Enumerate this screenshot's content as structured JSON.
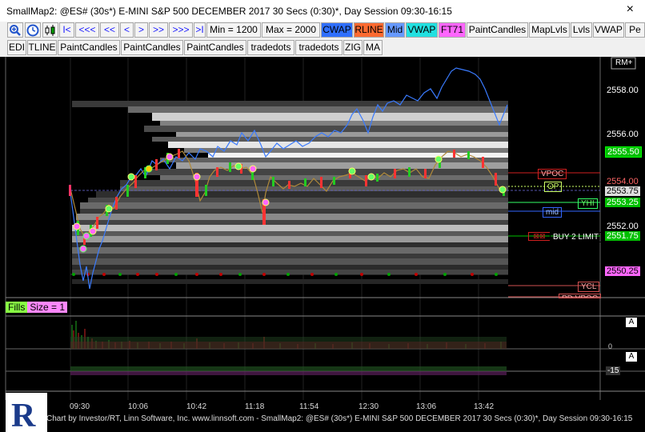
{
  "window": {
    "title": "SmallMap2: @ES# (30s*) E-MINI S&P 500 DECEMBER 2017 30 Secs (0:30)*, Day Session 09:30-16:15",
    "close": "×"
  },
  "toolbar1": {
    "nav": [
      "I<",
      "<<<",
      "<<",
      "<",
      ">",
      ">>",
      ">>>",
      ">I"
    ],
    "min": "Min = 1200",
    "max": "Max = 2000",
    "buttons": [
      "CWAP",
      "RLINE",
      "Mid",
      "VWAP",
      "FT71",
      "PaintCandles",
      "MapLvls",
      "Lvls",
      "VWAP",
      "Pe"
    ]
  },
  "toolbar2": {
    "buttons": [
      "EDI",
      "TLINE",
      "PaintCandles",
      "PaintCandles",
      "PaintCandles",
      "tradedots",
      "tradedots",
      "ZIG",
      "MA"
    ]
  },
  "chart": {
    "rm_button": "RM+",
    "price_labels": [
      "2558.00",
      "2556.00",
      "2555.50",
      "2554.00",
      "2553.75",
      "2553.25",
      "2552.00",
      "2551.75",
      "2550.25"
    ],
    "tags": {
      "vpoc": "VPOC",
      "op": "OP",
      "yhi": "YHI",
      "mid": "mid",
      "buy": "BUY 2 LIMIT",
      "ycl": "YCL",
      "pdvpoc": "PD VPOC"
    },
    "fills_label": "Fills",
    "size_label": "Size = 1",
    "pane_a1": "A",
    "pane_a2": "A",
    "pane_zero": "0",
    "pane_neg": "-15",
    "times": [
      "09:30",
      "10:06",
      "10:42",
      "11:18",
      "11:54",
      "12:30",
      "13:06",
      "13:42"
    ],
    "footer": "Chart by Investor/RT, Linn Software, Inc. www.linnsoft.com - SmallMap2: @ES# (30s*) E-MINI S&P 500 DECEMBER 2017 30 Secs (0:30)*, Day Session 09:30-16:15"
  },
  "colors": {
    "cwap": "#2f6fff",
    "rline": "#ff6a30",
    "mid": "#6699ff",
    "vwap": "#22e0e0",
    "ft71": "#ff66ff",
    "price_green": "#00c000",
    "tag_red": "#d02020",
    "tag_magenta": "#ff66ff"
  }
}
